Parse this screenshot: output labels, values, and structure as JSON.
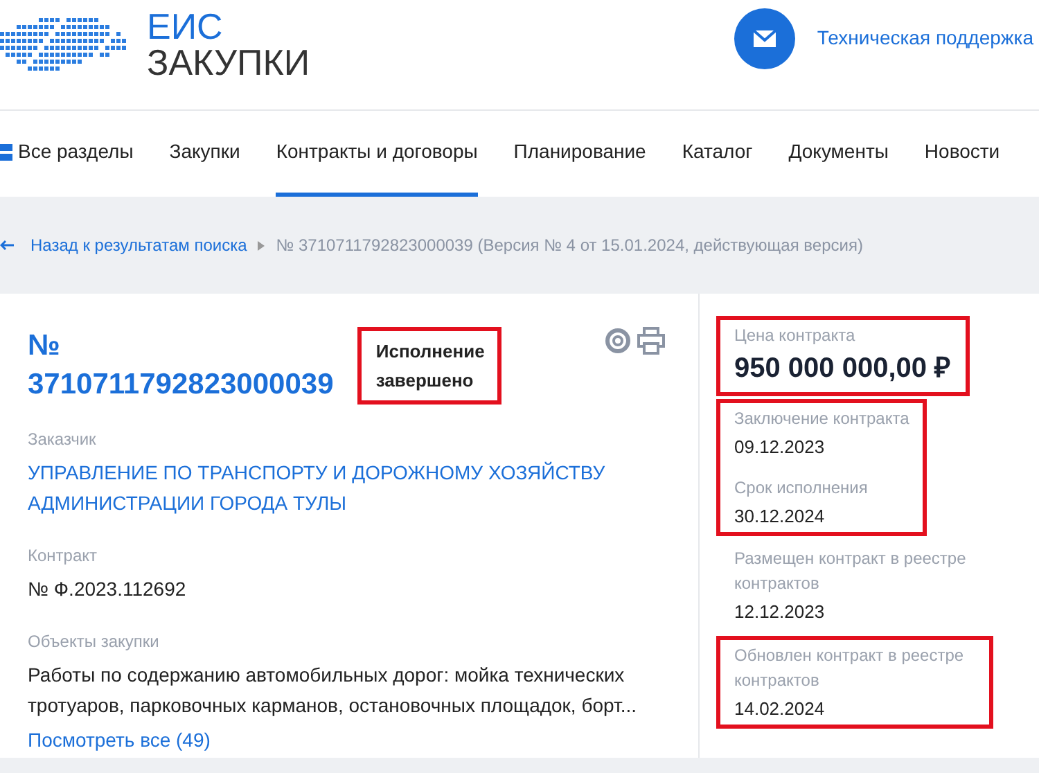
{
  "header": {
    "logo_line_1": "ЕИС",
    "logo_line_2": "ЗАКУПКИ",
    "support_link": "Техническая поддержка"
  },
  "nav": [
    {
      "label": "Все разделы",
      "kind": "menu",
      "selected": false
    },
    {
      "label": "Закупки",
      "kind": "tab",
      "selected": false
    },
    {
      "label": "Контракты и договоры",
      "kind": "tab",
      "selected": true
    },
    {
      "label": "Планирование",
      "kind": "tab",
      "selected": false
    },
    {
      "label": "Каталог",
      "kind": "tab",
      "selected": false
    },
    {
      "label": "Документы",
      "kind": "tab",
      "selected": false
    },
    {
      "label": "Новости",
      "kind": "tab",
      "selected": false
    }
  ],
  "breadcrumb": {
    "back_link": "Назад к результатам поиска",
    "current": "№ 3710711792823000039 (Версия № 4 от 15.01.2024, действующая версия)"
  },
  "contract": {
    "number_prefix": "№",
    "number": "3710711792823000039",
    "status": {
      "text": "Исполнение завершено",
      "highlighted": true
    },
    "fields": [
      {
        "label": "Заказчик",
        "value": "УПРАВЛЕНИЕ ПО ТРАНСПОРТУ И ДОРОЖНОМУ ХОЗЯЙСТВУ АДМИНИСТРАЦИИ ГОРОДА ТУЛЫ",
        "kind": "link"
      },
      {
        "label": "Контракт",
        "value": "№ Ф.2023.112692",
        "kind": "text"
      },
      {
        "label": "Объекты закупки",
        "value": "Работы по содержанию автомобильных дорог: мойка технических тротуаров, парковочных карманов, остановочных площадок, борт...",
        "kind": "text",
        "more_link": "Посмотреть все (49)"
      }
    ]
  },
  "side": [
    {
      "highlighted": true,
      "fields": [
        {
          "label": "Цена контракта",
          "value": "950 000 000,00 ₽",
          "kind": "price"
        }
      ]
    },
    {
      "highlighted": true,
      "fields": [
        {
          "label": "Заключение контракта",
          "value": "09.12.2023",
          "kind": "date"
        },
        {
          "label": "Срок исполнения",
          "value": "30.12.2024",
          "kind": "date"
        }
      ]
    },
    {
      "highlighted": false,
      "fields": [
        {
          "label": "Размещен контракт в реестре контрактов",
          "value": "12.12.2023",
          "kind": "date"
        }
      ]
    },
    {
      "highlighted": true,
      "fields": [
        {
          "label": "Обновлен контракт в реестре контрактов",
          "value": "14.02.2024",
          "kind": "date"
        }
      ]
    }
  ]
}
